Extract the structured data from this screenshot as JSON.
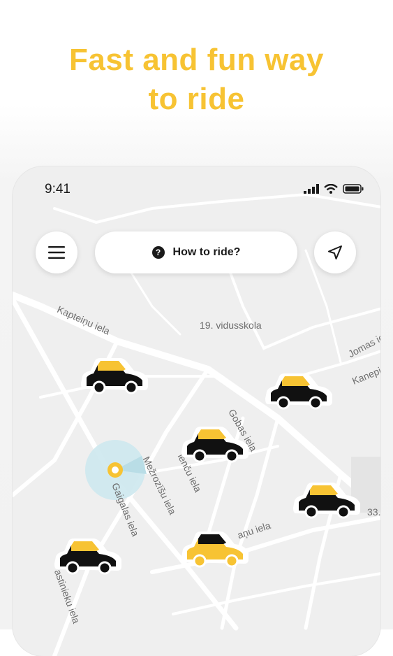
{
  "headline": {
    "line1": "Fast and fun way",
    "line2": "to ride"
  },
  "status_bar": {
    "time": "9:41"
  },
  "top_bar": {
    "menu_icon": "hamburger-menu-icon",
    "help_pill_label": "How to ride?",
    "help_icon_glyph": "?",
    "locate_icon": "navigation-arrow-icon"
  },
  "map": {
    "labels": {
      "kapteinu": "Kapteiņu iela",
      "school": "19. vidusskola",
      "jomas": "Jomas ies",
      "kanepi": "Kanepi",
      "gobas": "Gobas iela",
      "mezrozisu": "Mežrozīšu iela",
      "lienu": "ienču iela",
      "gaigalas": "Gaigalas iela",
      "anu": "aņu iela",
      "num33": "33.",
      "dastinieku": "astinieku iela"
    }
  },
  "colors": {
    "accent": "#f7c333",
    "car_dark": "#111111",
    "location_ring": "#cde8ee"
  }
}
